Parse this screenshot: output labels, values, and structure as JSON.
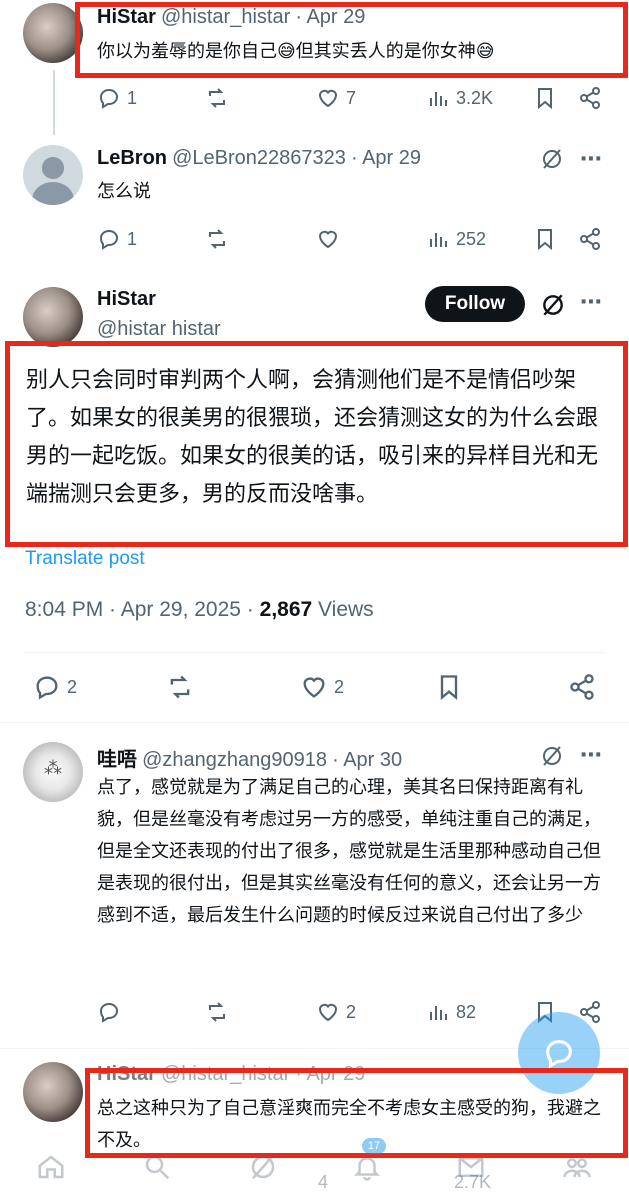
{
  "tweet1": {
    "name": "HiStar",
    "handle": "@histar_histar",
    "date": "· Apr 29",
    "text": "你以为羞辱的是你自己😅但其实丢人的是你女神😅",
    "replies": "1",
    "likes": "7",
    "views": "3.2K"
  },
  "tweet2": {
    "name": "LeBron",
    "handle": "@LeBron22867323",
    "date": "· Apr 29",
    "text": "怎么说",
    "replies": "1",
    "views": "252"
  },
  "main_tweet": {
    "name": "HiStar",
    "handle": "@histar histar",
    "follow_label": "Follow",
    "text": "别人只会同时审判两个人啊，会猜测他们是不是情侣吵架了。如果女的很美男的很猥琐，还会猜测这女的为什么会跟男的一起吃饭。如果女的很美的话，吸引来的异样目光和无端揣测只会更多，男的反而没啥事。",
    "translate": "Translate post",
    "time": "8:04 PM · Apr 29, 2025 · ",
    "views_count": "2,867",
    "views_label": " Views",
    "replies": "2",
    "likes": "2"
  },
  "tweet4": {
    "name": "哇唔",
    "handle": "@zhangzhang90918",
    "date": "· Apr 30",
    "text": "点了，感觉就是为了满足自己的心理，美其名曰保持距离有礼貌，但是丝毫没有考虑过另一方的感受，单纯注重自己的满足，但是全文还表现的付出了很多，感觉就是生活里那种感动自己但是表现的很付出，但是其实丝毫没有任何的意义，还会让另一方感到不适，最后发生什么问题的时候反过来说自己付出了多少",
    "likes": "2",
    "views": "82"
  },
  "tweet5": {
    "name": "HiStar",
    "handle": "@histar_histar",
    "date": "· Apr 29",
    "text": "总之这种只为了自己意淫爽而完全不考虑女主感受的狗，我避之不及。",
    "likes": "4",
    "views": "2.7K"
  },
  "nav": {
    "badge": "17"
  },
  "colors": {
    "highlight": "#e8281b",
    "link": "#1d9bf0",
    "muted": "#536471"
  }
}
